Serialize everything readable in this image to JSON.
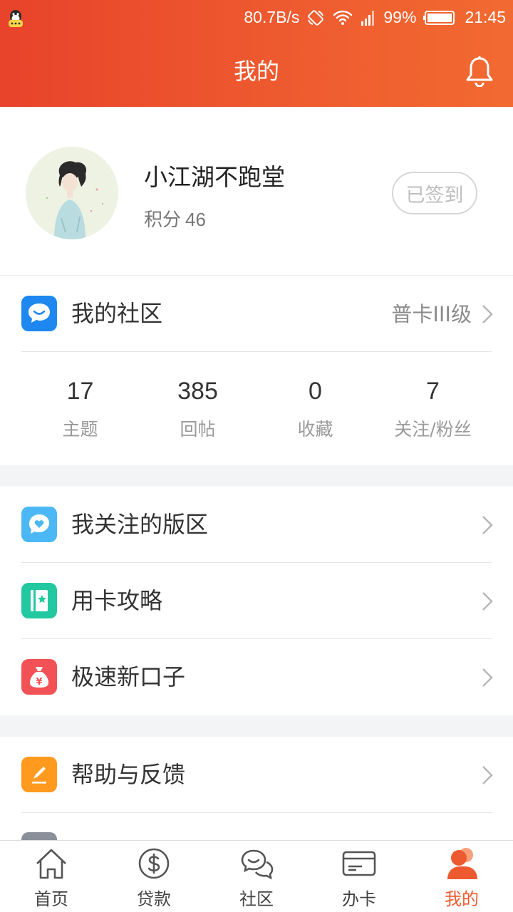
{
  "status_bar": {
    "net_speed": "80.7B/s",
    "battery": "99%",
    "time": "21:45"
  },
  "header": {
    "title": "我的"
  },
  "profile": {
    "username": "小江湖不跑堂",
    "points_label": "积分",
    "points_value": "46",
    "signin_label": "已签到"
  },
  "community": {
    "label": "我的社区",
    "level": "普卡III级",
    "stats": [
      {
        "value": "17",
        "label": "主题"
      },
      {
        "value": "385",
        "label": "回帖"
      },
      {
        "value": "0",
        "label": "收藏"
      },
      {
        "value": "7",
        "label": "关注/粉丝"
      }
    ]
  },
  "menu": [
    {
      "label": "我关注的版区",
      "icon": "heart-chat-icon",
      "color": "#4bb8f5"
    },
    {
      "label": "用卡攻略",
      "icon": "guide-book-icon",
      "color": "#22c9a0"
    },
    {
      "label": "极速新口子",
      "icon": "money-bag-icon",
      "color": "#f25255"
    }
  ],
  "menu2": [
    {
      "label": "帮助与反馈",
      "icon": "edit-pencil-icon",
      "color": "#ff9a1f"
    }
  ],
  "tabs": [
    {
      "label": "首页",
      "icon": "home-icon"
    },
    {
      "label": "贷款",
      "icon": "dollar-icon"
    },
    {
      "label": "社区",
      "icon": "chat-icon"
    },
    {
      "label": "办卡",
      "icon": "card-icon"
    },
    {
      "label": "我的",
      "icon": "user-icon",
      "active": true
    }
  ],
  "colors": {
    "accent": "#ee5a2f",
    "header_start": "#e8432b",
    "header_end": "#f26a31",
    "community_icon": "#1e88f0"
  }
}
